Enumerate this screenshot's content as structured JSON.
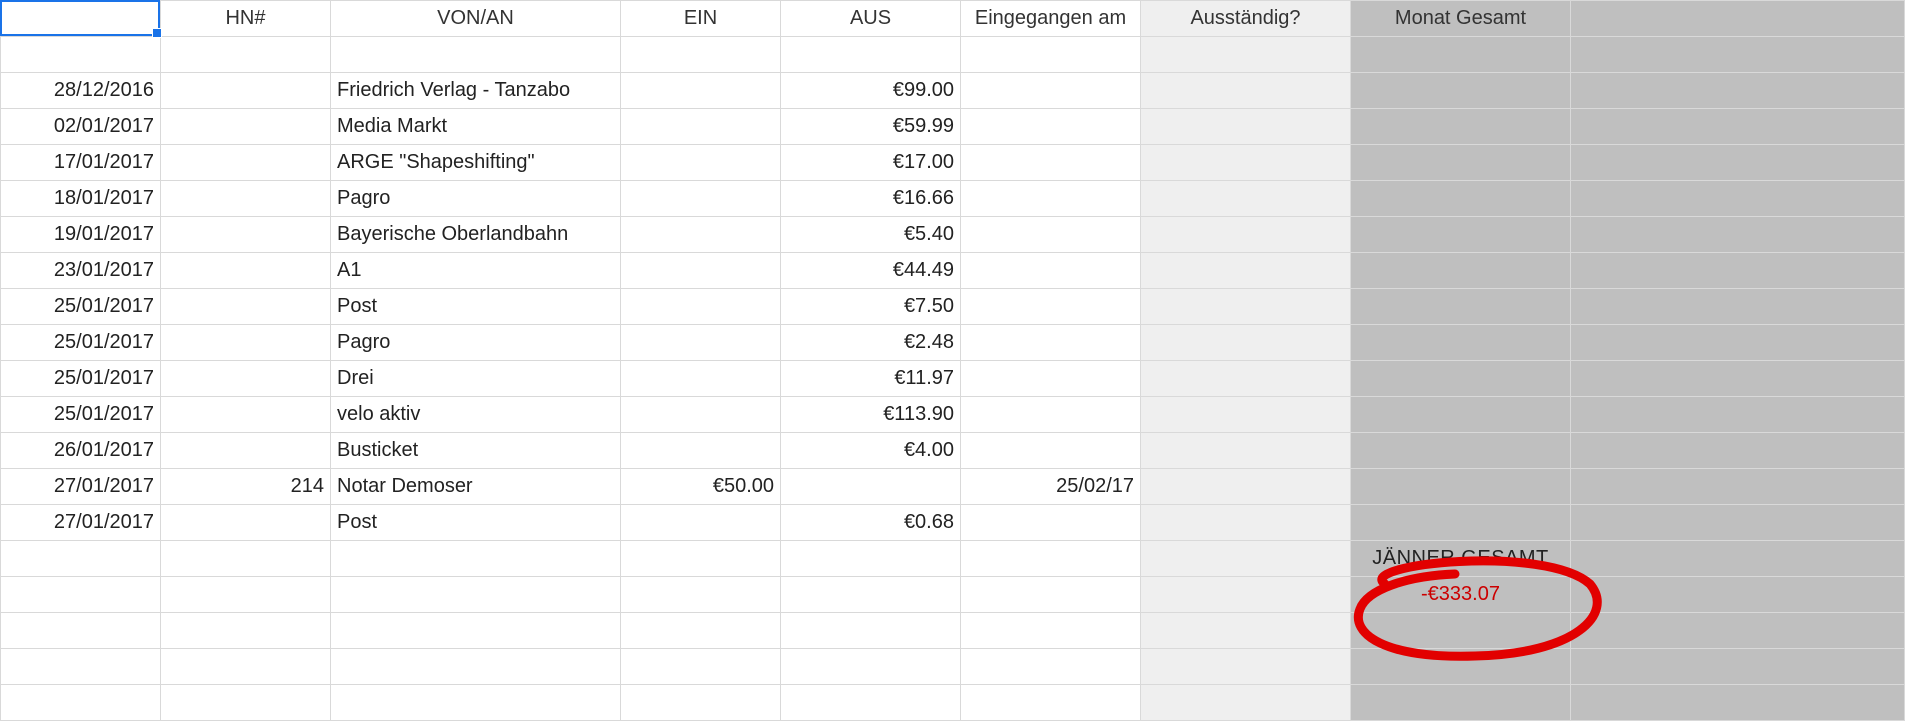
{
  "headers": {
    "date": "",
    "hn": "HN#",
    "von": "VON/AN",
    "ein": "EIN",
    "aus": "AUS",
    "eing": "Eingegangen am",
    "aust": "Ausständig?",
    "monat": "Monat Gesamt"
  },
  "rows": [
    {
      "date": "28/12/2016",
      "hn": "",
      "von": "Friedrich Verlag - Tanzabo",
      "ein": "",
      "aus": "€99.00",
      "eing": ""
    },
    {
      "date": "02/01/2017",
      "hn": "",
      "von": "Media Markt",
      "ein": "",
      "aus": "€59.99",
      "eing": ""
    },
    {
      "date": "17/01/2017",
      "hn": "",
      "von": "ARGE \"Shapeshifting\"",
      "ein": "",
      "aus": "€17.00",
      "eing": ""
    },
    {
      "date": "18/01/2017",
      "hn": "",
      "von": "Pagro",
      "ein": "",
      "aus": "€16.66",
      "eing": ""
    },
    {
      "date": "19/01/2017",
      "hn": "",
      "von": "Bayerische Oberlandbahn",
      "ein": "",
      "aus": "€5.40",
      "eing": ""
    },
    {
      "date": "23/01/2017",
      "hn": "",
      "von": "A1",
      "ein": "",
      "aus": "€44.49",
      "eing": ""
    },
    {
      "date": "25/01/2017",
      "hn": "",
      "von": "Post",
      "ein": "",
      "aus": "€7.50",
      "eing": ""
    },
    {
      "date": "25/01/2017",
      "hn": "",
      "von": "Pagro",
      "ein": "",
      "aus": "€2.48",
      "eing": ""
    },
    {
      "date": "25/01/2017",
      "hn": "",
      "von": "Drei",
      "ein": "",
      "aus": "€11.97",
      "eing": ""
    },
    {
      "date": "25/01/2017",
      "hn": "",
      "von": "velo aktiv",
      "ein": "",
      "aus": "€113.90",
      "eing": ""
    },
    {
      "date": "26/01/2017",
      "hn": "",
      "von": "Busticket",
      "ein": "",
      "aus": "€4.00",
      "eing": ""
    },
    {
      "date": "27/01/2017",
      "hn": "214",
      "von": "Notar Demoser",
      "ein": "€50.00",
      "aus": "",
      "eing": "25/02/17"
    },
    {
      "date": "27/01/2017",
      "hn": "",
      "von": "Post",
      "ein": "",
      "aus": "€0.68",
      "eing": ""
    }
  ],
  "summary": {
    "label": "JÄNNER GESAMT",
    "value": "-€333.07"
  }
}
